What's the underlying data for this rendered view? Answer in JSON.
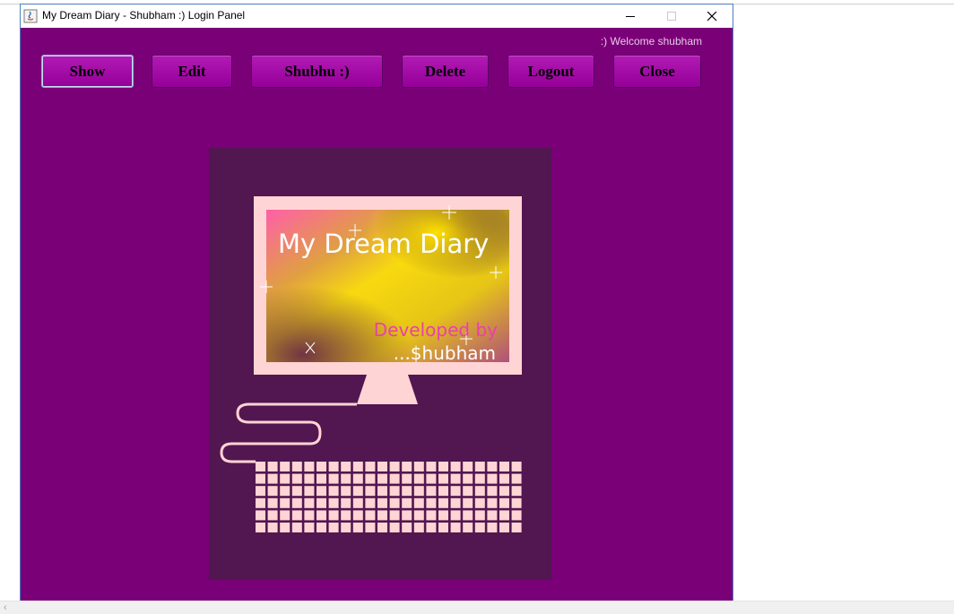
{
  "window": {
    "title": "My Dream Diary - Shubham :) Login Panel",
    "controls": {
      "minimize_icon": "minimize-icon",
      "maximize_icon": "maximize-icon",
      "close_icon": "close-icon"
    }
  },
  "header": {
    "welcome_text": ":) Welcome shubham"
  },
  "toolbar": {
    "buttons": [
      {
        "label": "Show"
      },
      {
        "label": "Edit"
      },
      {
        "label": "Shubhu :)"
      },
      {
        "label": "Delete"
      },
      {
        "label": "Logout"
      },
      {
        "label": "Close"
      }
    ]
  },
  "splash": {
    "title": "My Dream Diary",
    "developed_by": "Developed by",
    "author": "...$hubham"
  },
  "colors": {
    "window_bg": "#7a0078",
    "button_bg": "#a210a6",
    "splash_bg": "#521650",
    "accent_pink": "#ffd4d4"
  }
}
